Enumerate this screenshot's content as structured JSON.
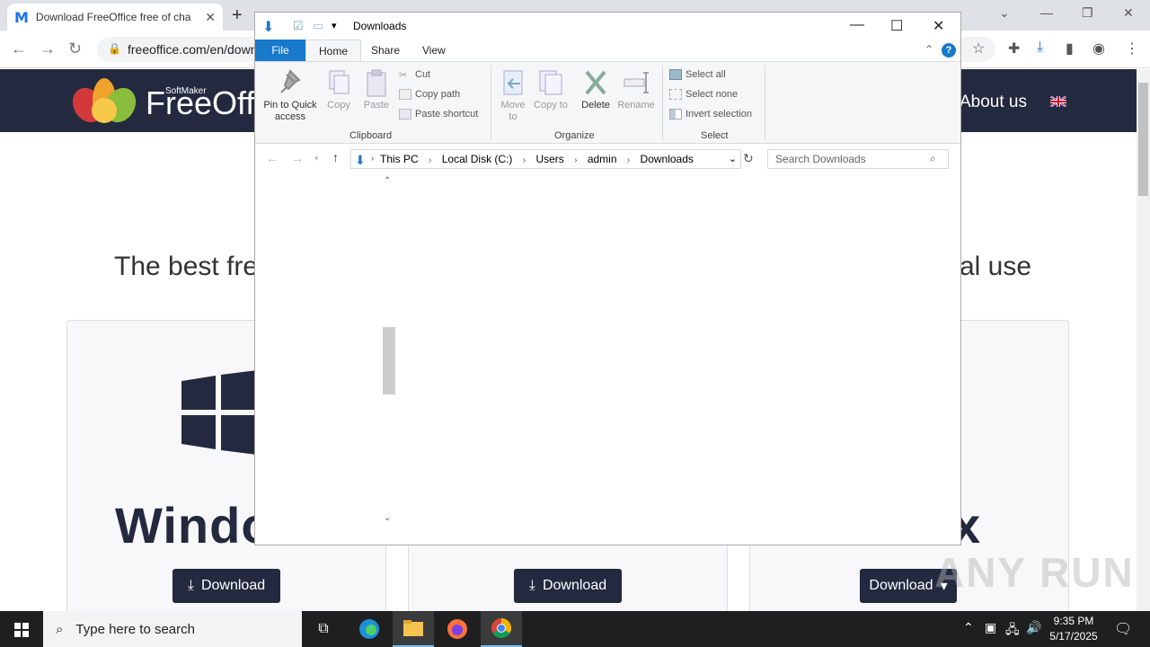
{
  "browser": {
    "tab_title": "Download FreeOffice free of cha",
    "favicon": "M",
    "url": "freeoffice.com/en/down"
  },
  "site": {
    "brand_small": "SoftMaker",
    "brand": "FreeOff",
    "nav_about": "About us",
    "headline_left": "The best fre",
    "headline_right": "al use",
    "card1_os": "Windo",
    "card3_os": "x",
    "download_label": "Download",
    "accent": "#232a3f"
  },
  "explorer": {
    "title": "Downloads",
    "tabs": {
      "file": "File",
      "home": "Home",
      "share": "Share",
      "view": "View"
    },
    "clipboard": {
      "pin": "Pin to Quick access",
      "copy": "Copy",
      "paste": "Paste",
      "cut": "Cut",
      "copy_path": "Copy path",
      "paste_shortcut": "Paste shortcut",
      "group": "Clipboard"
    },
    "organize": {
      "move_to": "Move to",
      "copy_to": "Copy to",
      "delete": "Delete",
      "rename": "Rename",
      "group": "Organize"
    },
    "select": {
      "select_all": "Select all",
      "select_none": "Select none",
      "invert": "Invert selection",
      "group": "Select"
    },
    "breadcrumb": [
      "This PC",
      "Local Disk (C:)",
      "Users",
      "admin",
      "Downloads"
    ],
    "search_placeholder": "Search Downloads"
  },
  "taskbar": {
    "search_placeholder": "Type here to search",
    "time": "9:35 PM",
    "date": "5/17/2025"
  },
  "watermark": "ANY RUN"
}
